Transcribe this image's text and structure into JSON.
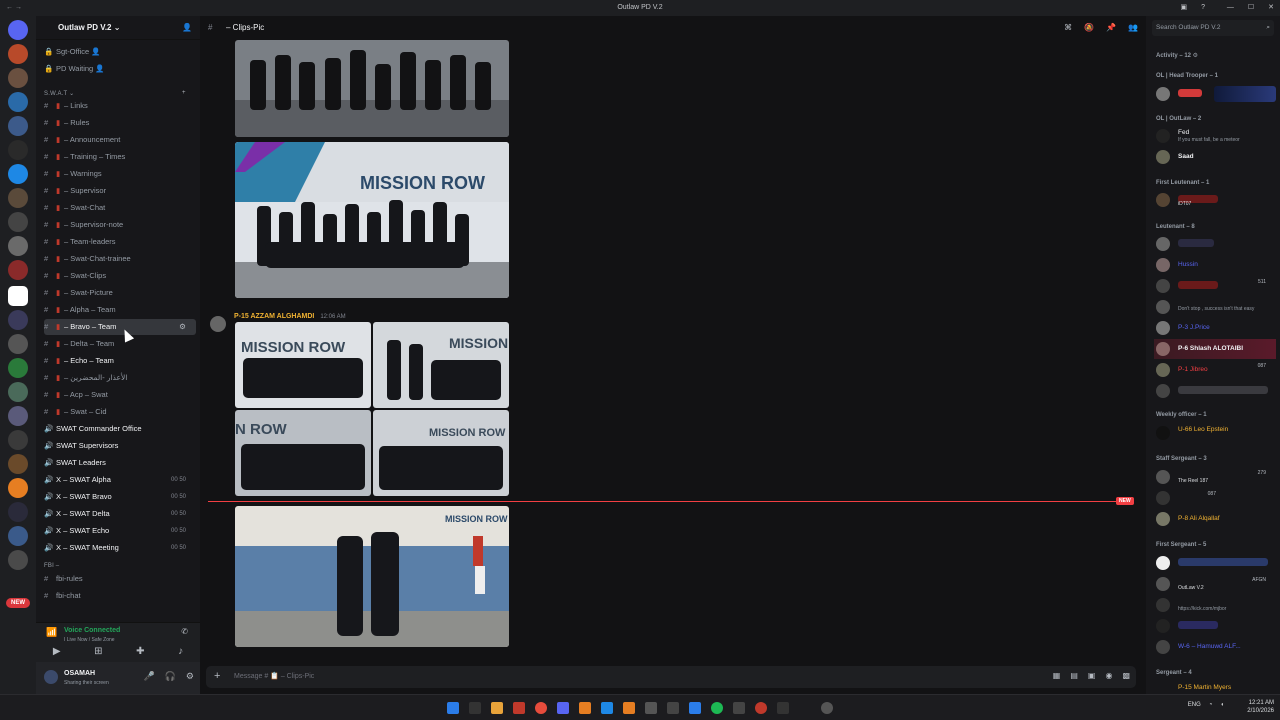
{
  "window": {
    "title": "Outlaw PD V.2"
  },
  "server": {
    "name": "Outlaw PD V.2",
    "add_label": "+"
  },
  "channels": {
    "top_items": [
      {
        "label": "Sgt-Office 👤",
        "prefix": "🔒"
      },
      {
        "label": "PD Waiting 👤",
        "prefix": "🔒"
      }
    ],
    "swat_category": "S.W.A.T",
    "swat_items": [
      {
        "label": "– Links"
      },
      {
        "label": "– Rules"
      },
      {
        "label": "– Announcement"
      },
      {
        "label": "– Training – Times"
      },
      {
        "label": "– Warnings"
      },
      {
        "label": "– Supervisor"
      },
      {
        "label": "– Swat-Chat"
      },
      {
        "label": "– Supervisor-note"
      },
      {
        "label": "– Team-leaders"
      },
      {
        "label": "– Swat-Chat-trainee"
      },
      {
        "label": "– Swat-Clips"
      },
      {
        "label": "– Swat-Picture"
      },
      {
        "label": "– Alpha – Team"
      },
      {
        "label": "– Bravo – Team"
      },
      {
        "label": "– Delta – Team"
      },
      {
        "label": "– Echo – Team"
      },
      {
        "label": "– الأعذار -المحضرين"
      },
      {
        "label": "– Acp – Swat"
      },
      {
        "label": "– Swat – Cid"
      }
    ],
    "voice_items": [
      {
        "label": "SWAT Commander Office",
        "counts": ""
      },
      {
        "label": "SWAT Supervisors",
        "counts": ""
      },
      {
        "label": "SWAT Leaders",
        "counts": ""
      },
      {
        "label": "X – SWAT Alpha",
        "counts": "00 50"
      },
      {
        "label": "X – SWAT Bravo",
        "counts": "00 50"
      },
      {
        "label": "X – SWAT Delta",
        "counts": "00 50"
      },
      {
        "label": "X – SWAT Echo",
        "counts": "00 50"
      },
      {
        "label": "X – SWAT Meeting",
        "counts": "00 50"
      }
    ],
    "fbi_category": "FBI –",
    "fbi_items": [
      {
        "label": "fbi-rules"
      },
      {
        "label": "fbi-chat"
      }
    ]
  },
  "voice": {
    "status": "Voice Connected",
    "sub": "I Live Now / Safe Zone"
  },
  "user": {
    "name": "OSAMAH",
    "status": "Sharing their screen"
  },
  "guild_badge": "NEW",
  "main": {
    "channel": "– Clips-Pic",
    "author": "P-15 AZZAM ALGHAMDI",
    "timestamp": "12:06 AM",
    "new_label": "NEW",
    "composer_placeholder": "Message # 📋 – Clips-Pic",
    "image_texts": [
      "MISSION ROW",
      "MISSION ROW",
      "MISSION",
      "N ROW",
      "MISSION ROW",
      "MISSION ROW POLICE DEP"
    ]
  },
  "members": {
    "search_placeholder": "Search Outlaw PD V.2",
    "groups": [
      {
        "label": "Activity – 12 ⚙"
      },
      {
        "label": "OL | Head Trooper – 1"
      },
      {
        "label": "OL | OutLaw – 2"
      },
      {
        "label": "First Leutenant – 1"
      },
      {
        "label": "Leutenant – 8"
      },
      {
        "label": "Weekly officer – 1"
      },
      {
        "label": "Staff Sergeant – 3"
      },
      {
        "label": "First Sergeant – 5"
      },
      {
        "label": "Sergeant – 4"
      }
    ],
    "people": [
      {
        "name": "Fed",
        "sub": "If you must fall, be a meteor",
        "color": "#f2f3f5"
      },
      {
        "name": "Saad",
        "sub": "",
        "color": "#f2f3f5"
      },
      {
        "name": "iDT07",
        "sub": "",
        "color": "#dbdee1"
      },
      {
        "name": "Hussin",
        "sub": "",
        "color": "#5865f2"
      },
      {
        "name": "Don't stop , success isn't that easy",
        "sub": "",
        "color": "#949ba4"
      },
      {
        "name": "P-3 J.Price",
        "sub": "",
        "color": "#5865f2"
      },
      {
        "name": "P-6 Shlash ALOTAIBI",
        "sub": "",
        "color": "#f23f43"
      },
      {
        "name": "P-1 Jibreo",
        "sub": "",
        "color": "#f23f43"
      },
      {
        "name": "U-66 Leo Epstein",
        "sub": "",
        "color": "#f0b232"
      },
      {
        "name": "The Reel 187",
        "sub": "",
        "color": "#dbdee1"
      },
      {
        "name": "P-8 Ali Alqallaf",
        "sub": "",
        "color": "#f0b232"
      },
      {
        "name": "OutLaw V.2",
        "sub": "",
        "color": "#dbdee1"
      },
      {
        "name": "https://kick.com/mjbor",
        "sub": "",
        "color": "#949ba4"
      },
      {
        "name": "W-6 – Hamuwd ALF...",
        "sub": "",
        "color": "#5865f2"
      },
      {
        "name": "P-15 Martin Myers",
        "sub": "",
        "color": "#f0b232"
      }
    ],
    "tags": {
      "ol": "OL",
      "n511": "511",
      "n087": "087",
      "n279": "279",
      "afgn": "AFGN"
    }
  },
  "taskbar": {
    "lang": "ENG",
    "time": "12:21 AM",
    "date": "2/10/2026"
  }
}
